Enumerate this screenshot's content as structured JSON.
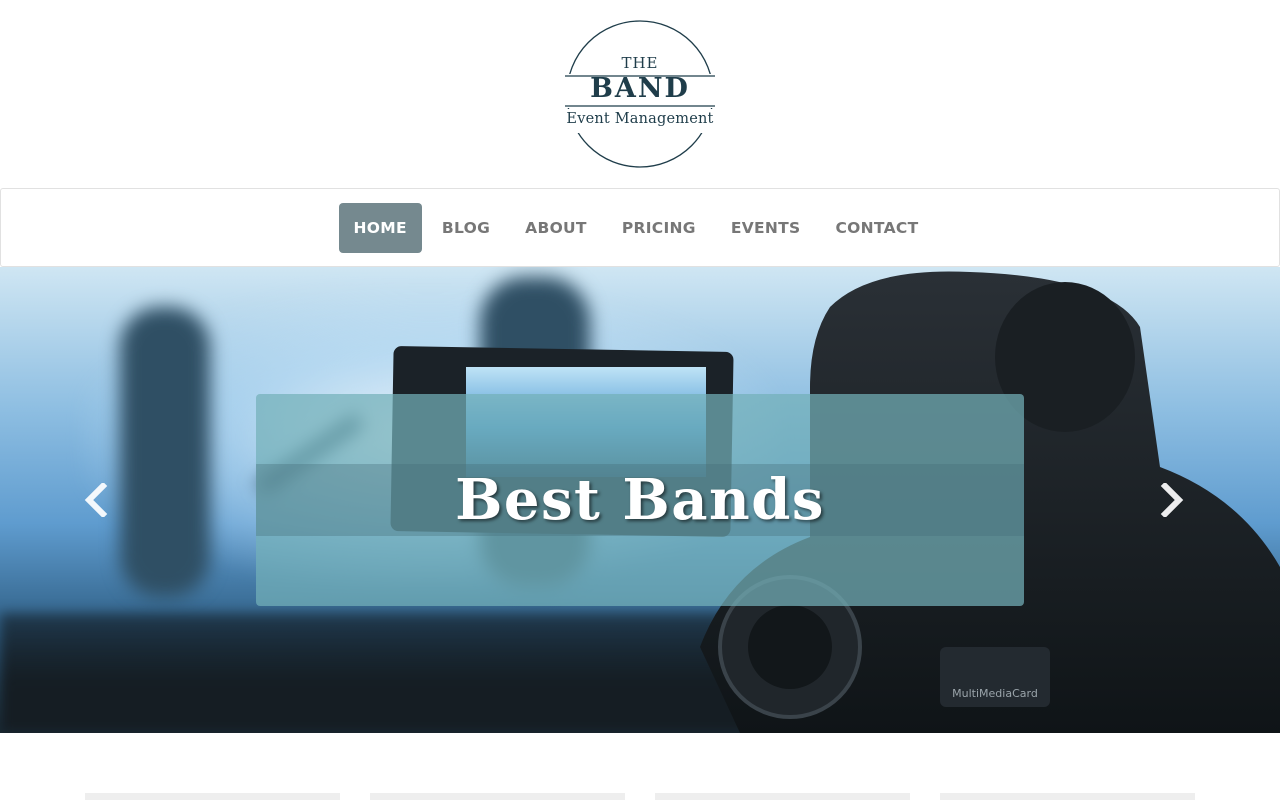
{
  "logo": {
    "line1": "THE",
    "line2": "BAND",
    "line3": "Event Management"
  },
  "nav": {
    "items": [
      "HOME",
      "BLOG",
      "ABOUT",
      "PRICING",
      "EVENTS",
      "CONTACT"
    ],
    "active": "HOME"
  },
  "hero": {
    "caption_title": "Best Bands",
    "prev_icon": "chevron-left-icon",
    "next_icon": "chevron-right-icon"
  },
  "colors": {
    "brand": "#1f3d4a",
    "nav_active_bg": "#75898f",
    "nav_text": "#777777",
    "caption_bg": "#73b0b9"
  }
}
